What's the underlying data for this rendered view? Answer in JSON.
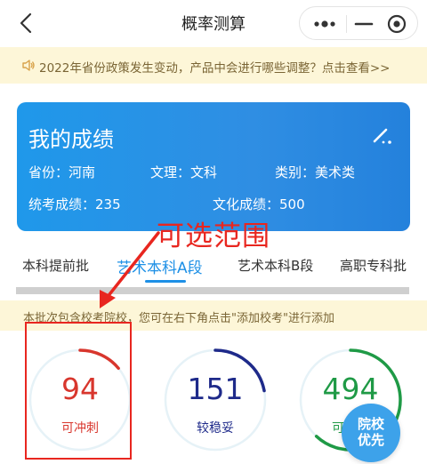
{
  "nav": {
    "title": "概率测算"
  },
  "notice": {
    "text": "2022年省份政策发生变动，产品中会进行哪些调整？点击查看>>"
  },
  "score_card": {
    "title": "我的成绩",
    "province": "省份：河南",
    "subject": "文理：文科",
    "category": "类别：美术类",
    "unified_score": "统考成绩：235",
    "culture_score": "文化成绩：500"
  },
  "annotation": {
    "text": "可选范围",
    "color": "#e8261f"
  },
  "tabs": [
    {
      "label": "本科提前批"
    },
    {
      "label": "艺术本科A段"
    },
    {
      "label": "艺术本科B段"
    },
    {
      "label": "高职专科批"
    }
  ],
  "tip": {
    "text": "本批次包含校考院校，您可在右下角点击\"添加校考\"进行添加"
  },
  "gauges": [
    {
      "count": "94",
      "label": "可冲刺",
      "color": "#d8362d",
      "fraction": 0.14
    },
    {
      "count": "151",
      "label": "较稳妥",
      "color": "#1e2a8a",
      "fraction": 0.22
    },
    {
      "count": "494",
      "label": "可保底",
      "color": "#1f9a46",
      "fraction": 0.62
    }
  ],
  "fab": {
    "line1": "院校",
    "line2": "优先"
  },
  "colors": {
    "accent": "#1e90e6",
    "card": "#2a8ee4",
    "notice_bg": "#fdf6d8"
  }
}
